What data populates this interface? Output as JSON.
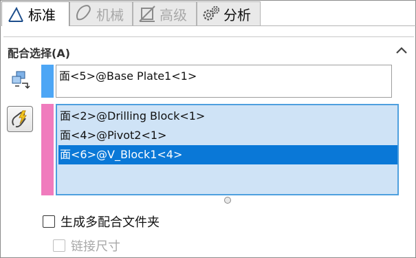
{
  "tabs": [
    {
      "label": "标准",
      "icon": "mate-angle-icon",
      "state": "active"
    },
    {
      "label": "机械",
      "icon": "cam-icon",
      "state": "disabled"
    },
    {
      "label": "高级",
      "icon": "advanced-mate-icon",
      "state": "disabled"
    },
    {
      "label": "分析",
      "icon": "gears-icon",
      "state": "normal"
    }
  ],
  "mate_selection": {
    "title": "配合选择(A)",
    "first_entities": [
      "面<5>@Base Plate1<1>"
    ],
    "second_entities": [
      "面<2>@Drilling Block<1>",
      "面<4>@Pivot2<1>",
      "面<6>@V_Block1<4>"
    ],
    "highlighted_index": 2
  },
  "options": {
    "multiple_mate_folder": {
      "label": "生成多配合文件夹",
      "checked": false
    },
    "link_dimensions": {
      "label": "链接尺寸",
      "checked": false,
      "enabled": false
    }
  },
  "colors": {
    "first_bar": "#4da6f5",
    "second_bar": "#f07bbd",
    "highlight": "#0a78d7",
    "list_selected_bg": "#cfe3f6"
  }
}
